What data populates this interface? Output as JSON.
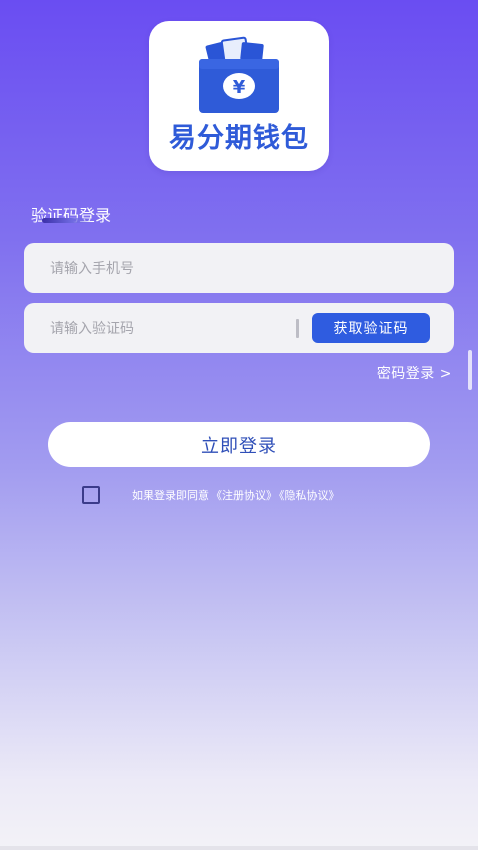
{
  "status_bar": {
    "left_text": "",
    "right_text": ""
  },
  "logo": {
    "text": "易分期钱包",
    "coin_symbol": "¥",
    "icon": "wallet-icon",
    "brand_color": "#2f5bd8"
  },
  "login": {
    "section_title": "验证码登录",
    "phone_placeholder": "请输入手机号",
    "code_placeholder": "请输入验证码",
    "get_code_label": "获取验证码",
    "password_login_label": "密码登录 >",
    "submit_label": "立即登录"
  },
  "agreement": {
    "prefix": "如果登录即同意",
    "terms_label": "《注册协议》",
    "privacy_label": "《隐私协议》",
    "checked": false
  },
  "colors": {
    "accent": "#2f5ce0",
    "gradient_top": "#6a4df2",
    "gradient_bottom": "#f3f2f7"
  }
}
